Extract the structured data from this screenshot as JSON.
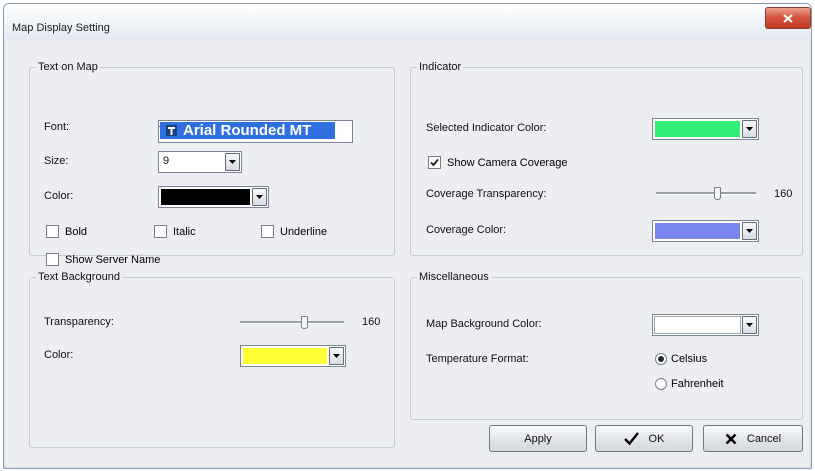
{
  "window": {
    "title": "Map Display Setting"
  },
  "text_on_map": {
    "legend": "Text on Map",
    "font_label": "Font:",
    "font_value": "Arial Rounded MT",
    "size_label": "Size:",
    "size_value": "9",
    "color_label": "Color:",
    "color_value": "#000000",
    "bold": {
      "label": "Bold",
      "checked": false
    },
    "italic": {
      "label": "Italic",
      "checked": false
    },
    "underline": {
      "label": "Underline",
      "checked": false
    },
    "show_server_name": {
      "label": "Show Server Name",
      "checked": false
    }
  },
  "text_background": {
    "legend": "Text Background",
    "transparency_label": "Transparency:",
    "transparency_value": "160",
    "transparency_max": 255,
    "color_label": "Color:",
    "color_value": "#ffff33"
  },
  "indicator": {
    "legend": "Indicator",
    "selected_color_label": "Selected Indicator Color:",
    "selected_color_value": "#33ee77",
    "show_camera_coverage": {
      "label": "Show Camera Coverage",
      "checked": true
    },
    "coverage_transparency_label": "Coverage Transparency:",
    "coverage_transparency_value": "160",
    "coverage_color_label": "Coverage Color:",
    "coverage_color_value": "#7a86ee"
  },
  "miscellaneous": {
    "legend": "Miscellaneous",
    "map_bg_label": "Map Background Color:",
    "map_bg_value": "#ffffff",
    "temperature_label": "Temperature Format:",
    "celsius": {
      "label": "Celsius",
      "selected": true
    },
    "fahrenheit": {
      "label": "Fahrenheit",
      "selected": false
    }
  },
  "buttons": {
    "apply": "Apply",
    "ok": "OK",
    "cancel": "Cancel"
  },
  "icons": {
    "close": "close-icon",
    "dropdown": "chevron-down-icon",
    "truetype": "truetype-font-icon",
    "ok": "checkmark-icon",
    "cancel": "x-icon"
  }
}
